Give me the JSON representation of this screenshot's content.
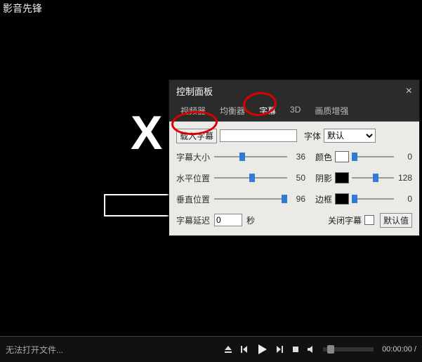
{
  "app_title": "影音先锋",
  "logo_text": "X",
  "panel": {
    "title": "控制面板",
    "tabs": [
      "视频器",
      "均衡器",
      "字幕",
      "3D",
      "画质增强"
    ],
    "active_tab_index": 2,
    "load_btn": "载入字幕",
    "subtitle_path": "",
    "font_label": "字体",
    "font_value": "默认",
    "size_label": "字幕大小",
    "size_value": "36",
    "hpos_label": "水平位置",
    "hpos_value": "50",
    "vpos_label": "垂直位置",
    "vpos_value": "96",
    "delay_label": "字幕延迟",
    "delay_value": "0",
    "delay_unit": "秒",
    "color_label": "颜色",
    "color_swatch": "#ffffff",
    "color_value": "0",
    "shadow_label": "阴影",
    "shadow_swatch": "#000000",
    "shadow_value": "128",
    "border_label": "边框",
    "border_swatch": "#000000",
    "border_value": "0",
    "close_sub_label": "关闭字幕",
    "default_btn": "默认值"
  },
  "bottom": {
    "status": "无法打开文件...",
    "time": "00:00:00 /"
  }
}
